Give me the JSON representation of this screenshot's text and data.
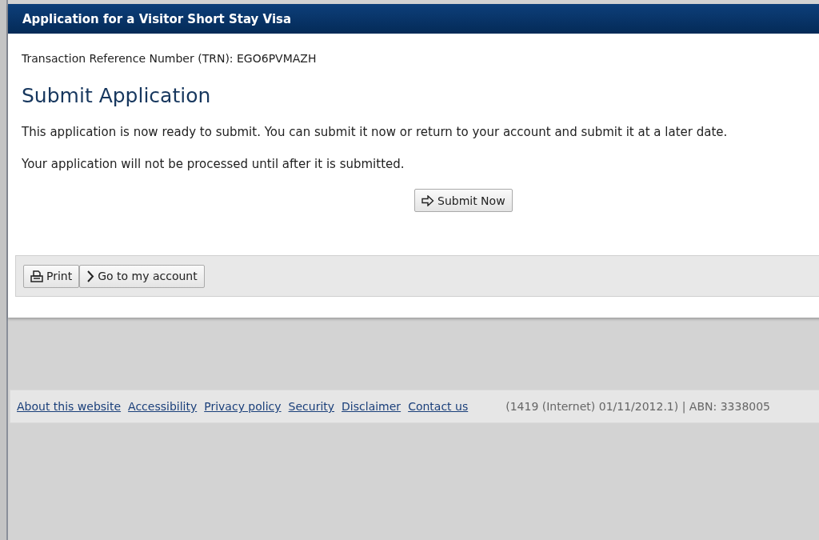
{
  "header": {
    "title": "Application for a Visitor Short Stay Visa"
  },
  "trn": "Transaction Reference Number (TRN): EGO6PVMAZH",
  "heading": "Submit Application",
  "paragraphs": [
    "This application is now ready to submit. You can submit it now or return to your account and submit it at a later date.",
    "Your application will not be processed until after it is submitted."
  ],
  "submit_button": {
    "label": "Submit Now"
  },
  "toolbar": [
    {
      "kind": "print",
      "label": "Print"
    },
    {
      "kind": "account",
      "label": "Go to my account"
    }
  ],
  "footer": {
    "links": [
      "About this website",
      "Accessibility",
      "Privacy policy",
      "Security",
      "Disclaimer",
      "Contact us"
    ],
    "info": "(1419 (Internet) 01/11/2012.1) | ABN: 3338005"
  }
}
